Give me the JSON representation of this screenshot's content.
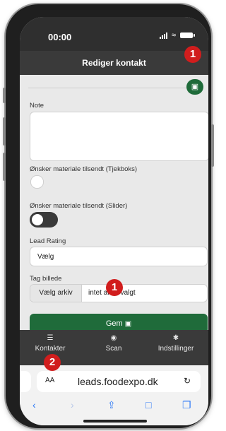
{
  "status": {
    "time": "00:00"
  },
  "app": {
    "title": "Rediger kontakt",
    "fields": {
      "note_label": "Note",
      "checkbox_label": "Ønsker materiale tilsendt (Tjekboks)",
      "slider_label": "Ønsker materiale tilsendt (Slider)",
      "lead_rating_label": "Lead Rating",
      "lead_rating_value": "Vælg",
      "photo_label": "Tag billede",
      "choose_file_button": "Vælg arkiv",
      "choose_file_status": "intet arkiv valgt"
    },
    "save_button": "Gem",
    "tabs": [
      {
        "label": "Kontakter",
        "icon": "list-icon"
      },
      {
        "label": "Scan",
        "icon": "camera-icon"
      },
      {
        "label": "Indstillinger",
        "icon": "gear-icon"
      }
    ]
  },
  "browser": {
    "text_size": "AA",
    "url": "leads.foodexpo.dk"
  },
  "annotations": [
    "1",
    "1",
    "2"
  ],
  "colors": {
    "accent_green": "#1f6b3a",
    "dark_bar": "#3a3a3a",
    "badge_red": "#d11d1d",
    "link_blue": "#2f7bf6"
  }
}
